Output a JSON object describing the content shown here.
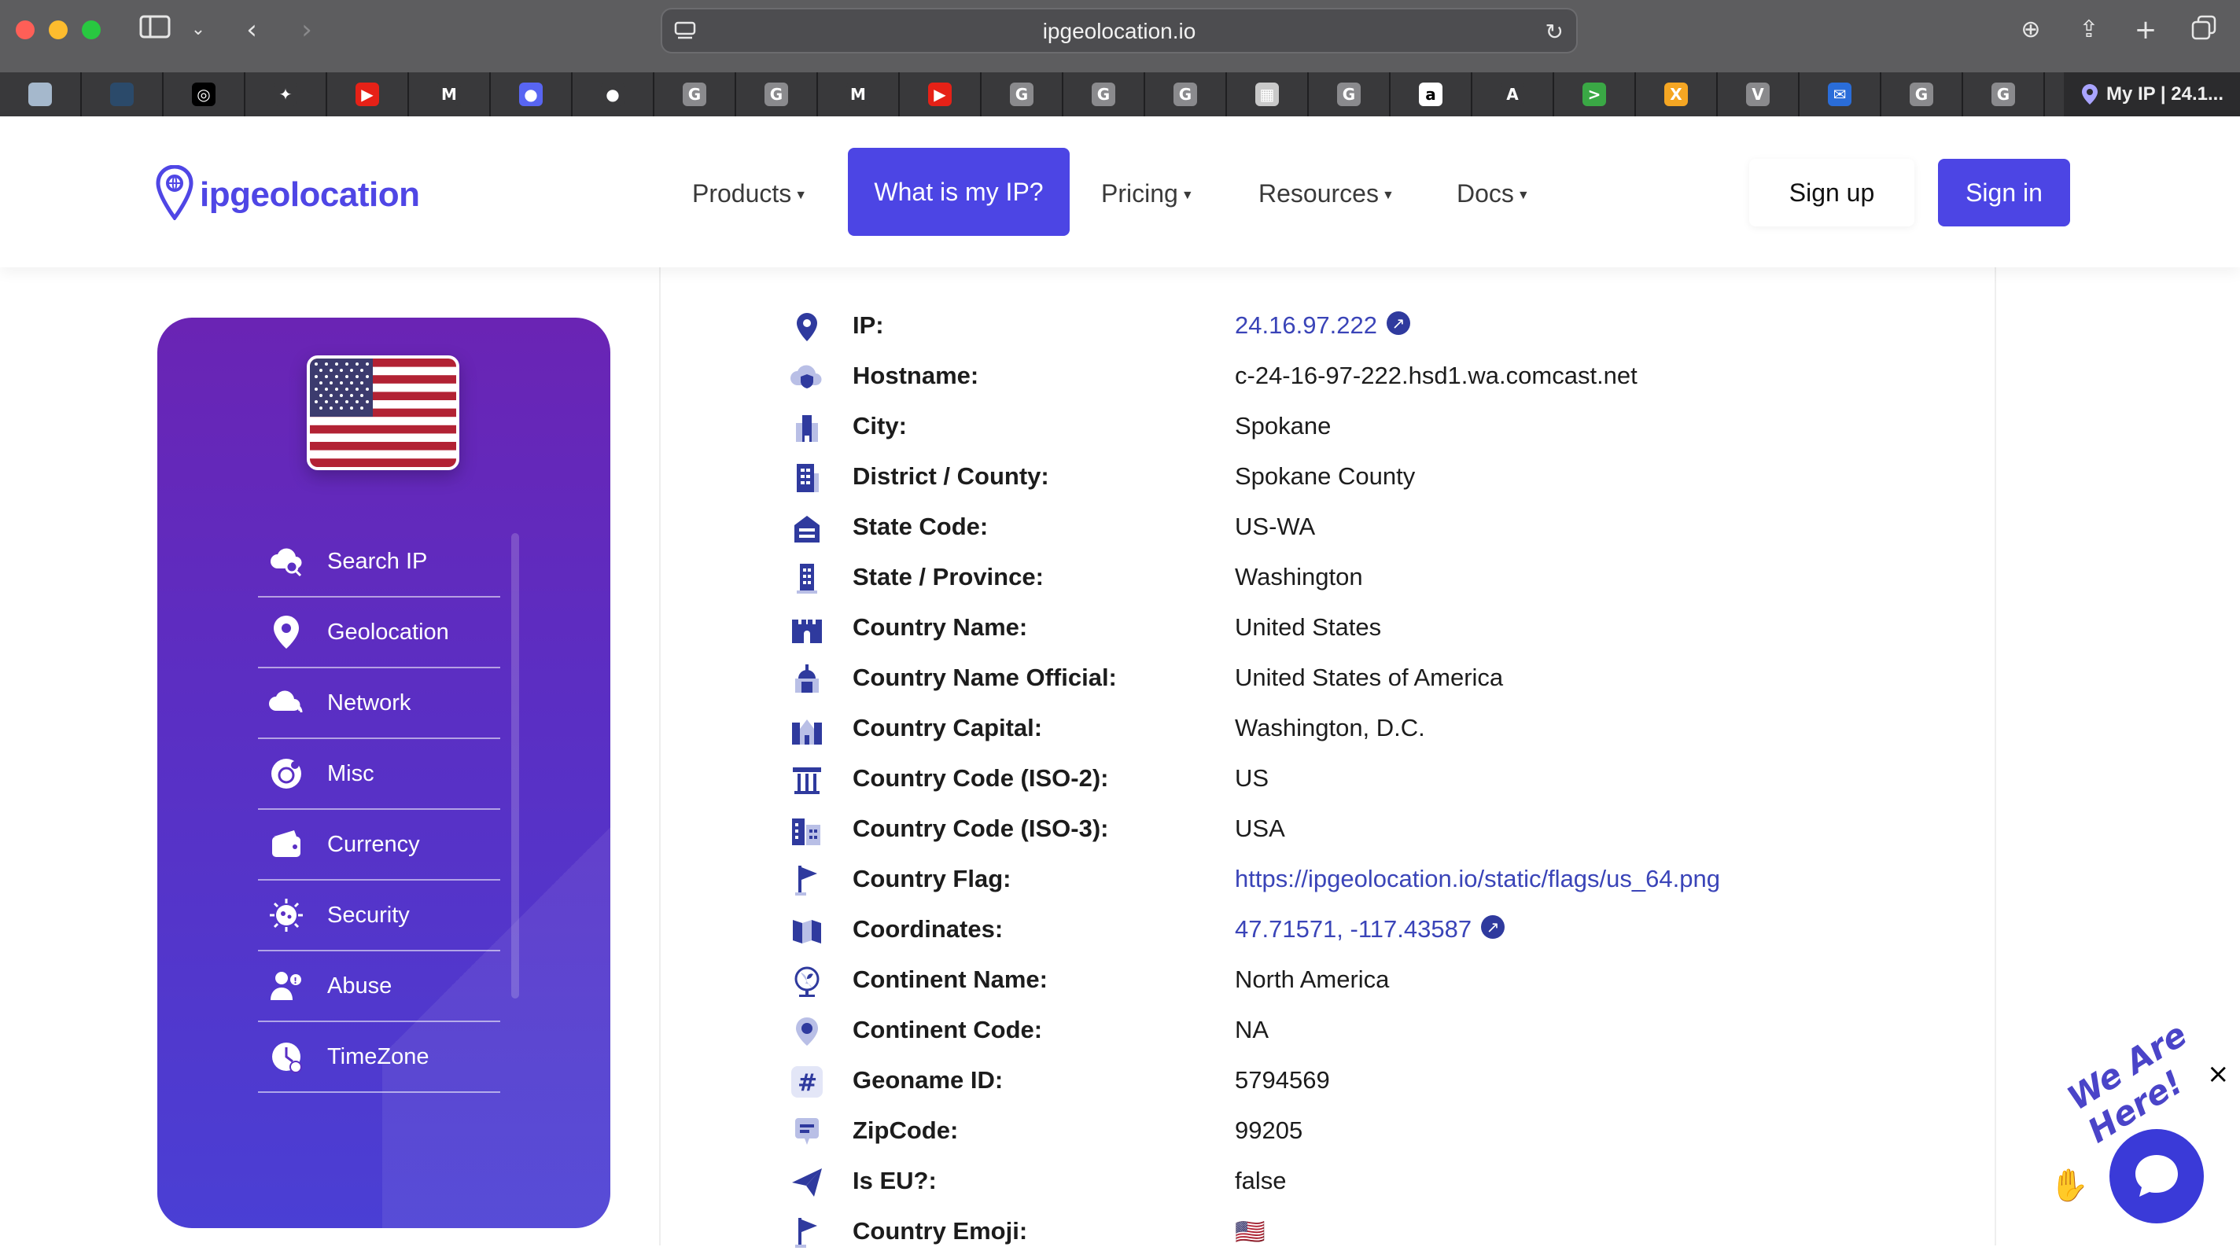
{
  "browser": {
    "url": "ipgeolocation.io",
    "active_tab_title": "My IP | 24.1...",
    "tabs": [
      {
        "icon": "noc-tab-icon",
        "glyph": "",
        "bg": "#a5b8cc"
      },
      {
        "icon": "scui-tab-icon",
        "glyph": "",
        "bg": "#2b4a6a"
      },
      {
        "icon": "openai-tab-icon",
        "glyph": "◎",
        "bg": "#000000"
      },
      {
        "icon": "gemini-tab-icon",
        "glyph": "✦",
        "bg": "#39393b"
      },
      {
        "icon": "youtube-tab-icon",
        "glyph": "▶",
        "bg": "#e62117"
      },
      {
        "icon": "gmail-tab-icon",
        "glyph": "M",
        "bg": "#39393b"
      },
      {
        "icon": "discord-tab-icon",
        "glyph": "●",
        "bg": "#5865f2"
      },
      {
        "icon": "github-tab-icon",
        "glyph": "●",
        "bg": "#39393b"
      },
      {
        "icon": "google-tab-icon",
        "glyph": "G",
        "bg": "#8a8a8d"
      },
      {
        "icon": "google-tab-icon",
        "glyph": "G",
        "bg": "#8a8a8d"
      },
      {
        "icon": "gmail-tab-icon",
        "glyph": "M",
        "bg": "#39393b"
      },
      {
        "icon": "youtube-tab-icon",
        "glyph": "▶",
        "bg": "#e62117"
      },
      {
        "icon": "google-tab-icon",
        "glyph": "G",
        "bg": "#8a8a8d"
      },
      {
        "icon": "google-tab-icon",
        "glyph": "G",
        "bg": "#8a8a8d"
      },
      {
        "icon": "google-tab-icon",
        "glyph": "G",
        "bg": "#8a8a8d"
      },
      {
        "icon": "image-tab-icon",
        "glyph": "▦",
        "bg": "#c9c9c9"
      },
      {
        "icon": "google-tab-icon",
        "glyph": "G",
        "bg": "#8a8a8d"
      },
      {
        "icon": "amazon-tab-icon",
        "glyph": "a",
        "bg": "#ffffff"
      },
      {
        "icon": "azure-tab-icon",
        "glyph": "A",
        "bg": "#39393b"
      },
      {
        "icon": "terminal-tab-icon",
        "glyph": ">",
        "bg": "#3aa845"
      },
      {
        "icon": "x-tab-icon",
        "glyph": "X",
        "bg": "#f5a623"
      },
      {
        "icon": "v-tab-icon",
        "glyph": "V",
        "bg": "#8a8a8d"
      },
      {
        "icon": "mail-tab-icon",
        "glyph": "✉",
        "bg": "#2a6dd9"
      },
      {
        "icon": "google-tab-icon",
        "glyph": "G",
        "bg": "#8a8a8d"
      },
      {
        "icon": "google-tab-icon",
        "glyph": "G",
        "bg": "#8a8a8d"
      }
    ]
  },
  "header": {
    "logo_text": "ipgeolocation",
    "nav": {
      "products": "Products",
      "what_is_my_ip": "What is my IP?",
      "pricing": "Pricing",
      "resources": "Resources",
      "docs": "Docs"
    },
    "sign_up": "Sign up",
    "sign_in": "Sign in"
  },
  "sidebar": {
    "items": [
      {
        "label": "Search IP",
        "icon": "cloud-search-icon"
      },
      {
        "label": "Geolocation",
        "icon": "location-pin-icon"
      },
      {
        "label": "Network",
        "icon": "cloud-network-icon"
      },
      {
        "label": "Misc",
        "icon": "misc-icon"
      },
      {
        "label": "Currency",
        "icon": "wallet-icon"
      },
      {
        "label": "Security",
        "icon": "virus-shield-icon"
      },
      {
        "label": "Abuse",
        "icon": "user-abuse-icon"
      },
      {
        "label": "TimeZone",
        "icon": "clock-icon"
      }
    ]
  },
  "details": [
    {
      "label": "IP:",
      "value": "24.16.97.222",
      "link": true,
      "ext": true,
      "icon": "pin-icon"
    },
    {
      "label": "Hostname:",
      "value": "c-24-16-97-222.hsd1.wa.comcast.net",
      "link": false,
      "ext": false,
      "icon": "cloud-shield-icon"
    },
    {
      "label": "City:",
      "value": "Spokane",
      "link": false,
      "ext": false,
      "icon": "city-icon"
    },
    {
      "label": "District / County:",
      "value": "Spokane County",
      "link": false,
      "ext": false,
      "icon": "building-icon"
    },
    {
      "label": "State Code:",
      "value": "US-WA",
      "link": false,
      "ext": false,
      "icon": "house-icon"
    },
    {
      "label": "State / Province:",
      "value": "Washington",
      "link": false,
      "ext": false,
      "icon": "tower-icon"
    },
    {
      "label": "Country Name:",
      "value": "United States",
      "link": false,
      "ext": false,
      "icon": "castle-icon"
    },
    {
      "label": "Country Name Official:",
      "value": "United States of America",
      "link": false,
      "ext": false,
      "icon": "capitol-icon"
    },
    {
      "label": "Country Capital:",
      "value": "Washington, D.C.",
      "link": false,
      "ext": false,
      "icon": "capital-icon"
    },
    {
      "label": "Country Code (ISO-2):",
      "value": "US",
      "link": false,
      "ext": false,
      "icon": "pillar-icon"
    },
    {
      "label": "Country Code (ISO-3):",
      "value": "USA",
      "link": false,
      "ext": false,
      "icon": "buildings-icon"
    },
    {
      "label": "Country Flag:",
      "value": "https://ipgeolocation.io/static/flags/us_64.png",
      "link": true,
      "ext": false,
      "icon": "flag-icon"
    },
    {
      "label": "Coordinates:",
      "value": "47.71571, -117.43587",
      "link": true,
      "ext": true,
      "icon": "map-icon"
    },
    {
      "label": "Continent Name:",
      "value": "North America",
      "link": false,
      "ext": false,
      "icon": "globe-icon"
    },
    {
      "label": "Continent Code:",
      "value": "NA",
      "link": false,
      "ext": false,
      "icon": "location-icon"
    },
    {
      "label": "Geoname ID:",
      "value": "5794569",
      "link": false,
      "ext": false,
      "icon": "hash-icon"
    },
    {
      "label": "ZipCode:",
      "value": "99205",
      "link": false,
      "ext": false,
      "icon": "zip-icon"
    },
    {
      "label": "Is EU?:",
      "value": "false",
      "link": false,
      "ext": false,
      "icon": "paper-plane-icon"
    },
    {
      "label": "Country Emoji:",
      "value": "🇺🇸",
      "link": false,
      "ext": false,
      "icon": "flag-icon"
    }
  ],
  "chat": {
    "tagline": "We Are Here!",
    "close": "×"
  },
  "colors": {
    "brand": "#4c45e4",
    "link": "#3a44b8",
    "icon": "#2f3a9e"
  }
}
